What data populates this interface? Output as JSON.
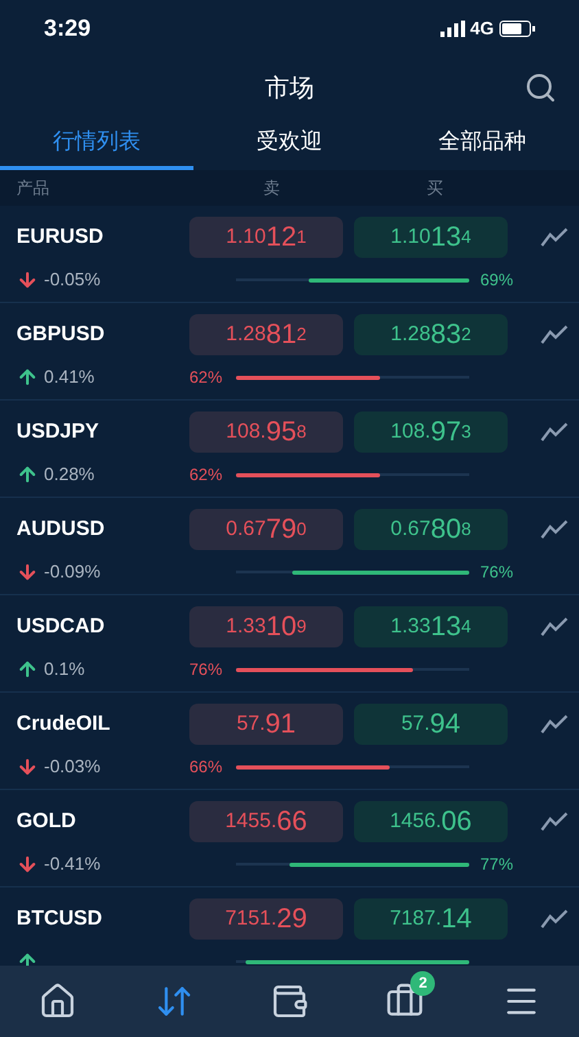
{
  "status_bar": {
    "time": "3:29",
    "network": "4G"
  },
  "header": {
    "title": "市场"
  },
  "tabs": [
    {
      "label": "行情列表",
      "selected": true
    },
    {
      "label": "受欢迎",
      "selected": false
    },
    {
      "label": "全部品种",
      "selected": false
    }
  ],
  "columns": [
    "产品",
    "卖",
    "买"
  ],
  "rows": [
    {
      "symbol": "EURUSD",
      "rising": false,
      "change": "-0.05%",
      "sell": [
        "1.10",
        "12",
        "1"
      ],
      "buy": [
        "1.10",
        "13",
        "4"
      ],
      "buy_majority": true,
      "level": 0.69,
      "percent": "69%"
    },
    {
      "symbol": "GBPUSD",
      "rising": true,
      "change": "0.41%",
      "sell": [
        "1.28",
        "81",
        "2"
      ],
      "buy": [
        "1.28",
        "83",
        "2"
      ],
      "buy_majority": false,
      "level": 0.62,
      "percent": "62%"
    },
    {
      "symbol": "USDJPY",
      "rising": true,
      "change": "0.28%",
      "sell": [
        "108.",
        "95",
        "8"
      ],
      "buy": [
        "108.",
        "97",
        "3"
      ],
      "buy_majority": false,
      "level": 0.62,
      "percent": "62%"
    },
    {
      "symbol": "AUDUSD",
      "rising": false,
      "change": "-0.09%",
      "sell": [
        "0.67",
        "79",
        "0"
      ],
      "buy": [
        "0.67",
        "80",
        "8"
      ],
      "buy_majority": true,
      "level": 0.76,
      "percent": "76%"
    },
    {
      "symbol": "USDCAD",
      "rising": true,
      "change": "0.1%",
      "sell": [
        "1.33",
        "10",
        "9"
      ],
      "buy": [
        "1.33",
        "13",
        "4"
      ],
      "buy_majority": false,
      "level": 0.76,
      "percent": "76%"
    },
    {
      "symbol": "CrudeOIL",
      "rising": false,
      "change": "-0.03%",
      "sell": [
        "57.",
        "91"
      ],
      "buy": [
        "57.",
        "94"
      ],
      "buy_majority": false,
      "level": 0.66,
      "percent": "66%"
    },
    {
      "symbol": "GOLD",
      "rising": false,
      "change": "-0.41%",
      "sell": [
        "1455.",
        "66"
      ],
      "buy": [
        "1456.",
        "06"
      ],
      "buy_majority": true,
      "level": 0.77,
      "percent": "77%"
    },
    {
      "symbol": "BTCUSD",
      "rising": true,
      "sell": [
        "7151.",
        "29"
      ],
      "buy": [
        "7187.",
        "14"
      ],
      "buy_majority": true,
      "level": 0.96
    }
  ],
  "bottom_nav": [
    {
      "kind": "home",
      "selected": false
    },
    {
      "kind": "trade",
      "selected": true
    },
    {
      "kind": "wallet",
      "selected": false
    },
    {
      "kind": "portfolio",
      "selected": false,
      "badge": "2"
    },
    {
      "kind": "menu",
      "selected": false
    }
  ]
}
